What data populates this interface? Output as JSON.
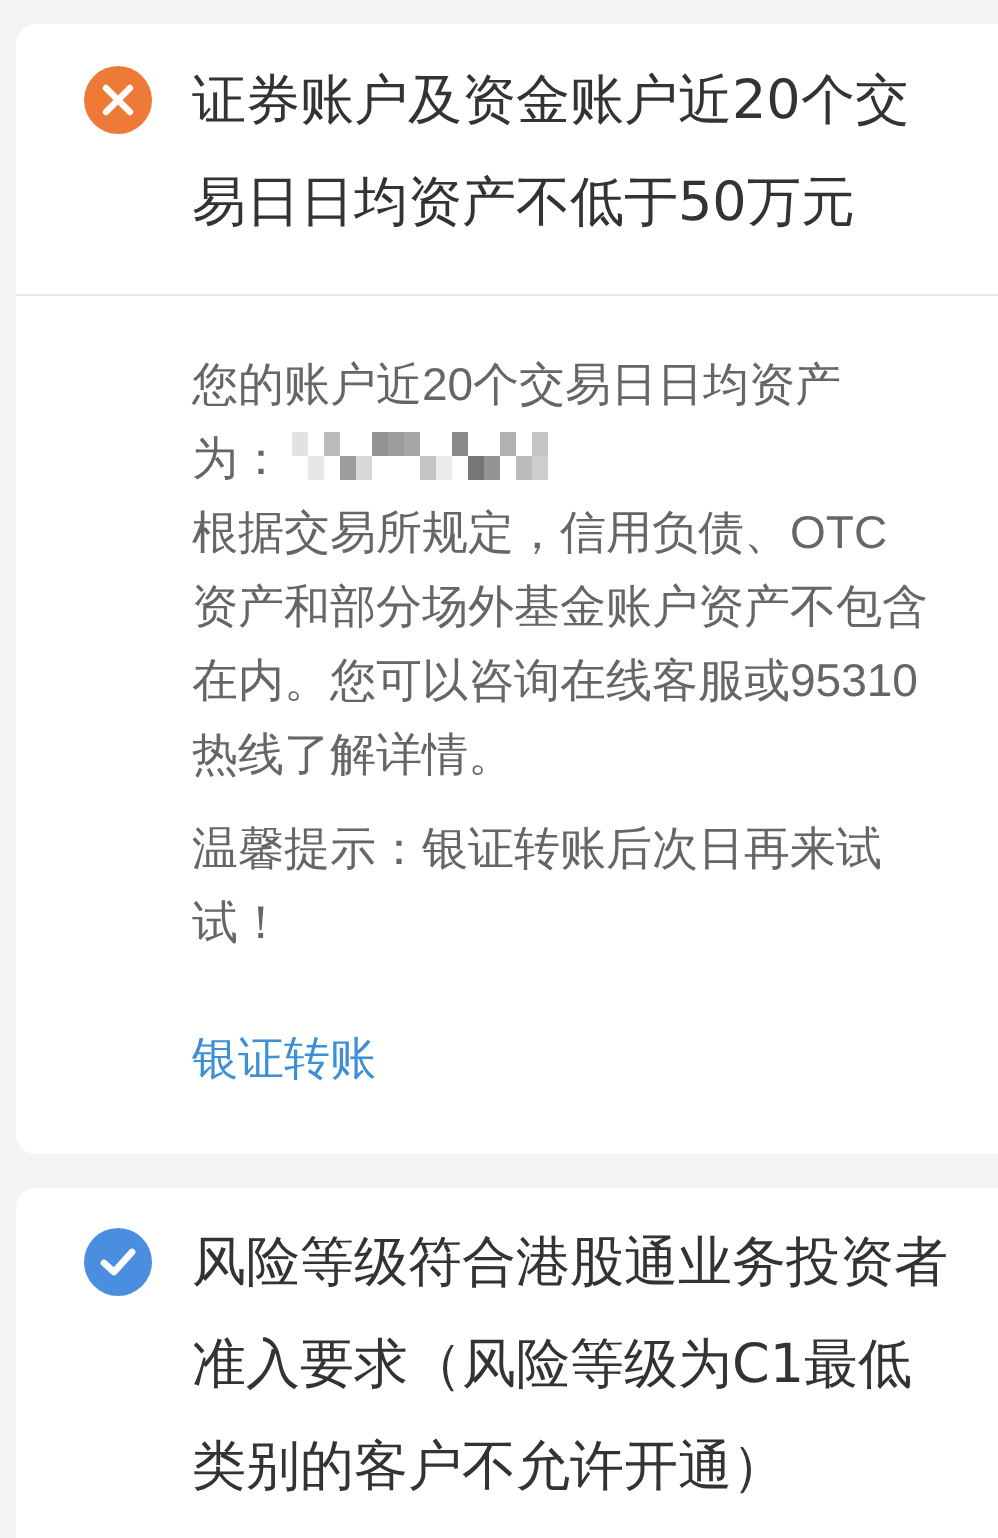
{
  "requirements": [
    {
      "kind": "failed",
      "title": "证券账户及资金账户近20个交易日日均资产不低于50万元",
      "details": [
        {
          "text": "您的账户近20个交易日日均资产为：",
          "masked": true
        },
        {
          "text": "根据交易所规定，信用负债、OTC资产和部分场外基金账户资产不包含在内。您可以咨询在线客服或95310热线了解详情。",
          "masked": false
        },
        {
          "text": "温馨提示：银证转账后次日再来试试！",
          "masked": false
        }
      ],
      "link": "银证转账"
    },
    {
      "kind": "passed",
      "title": "风险等级符合港股通业务投资者准入要求（风险等级为C1最低类别的客户不允许开通）"
    }
  ]
}
